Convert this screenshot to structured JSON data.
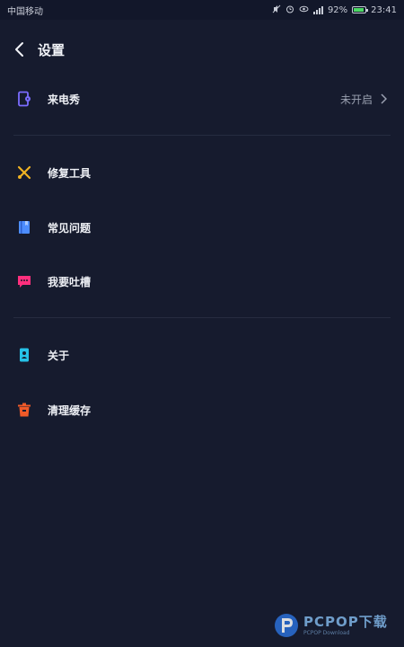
{
  "status_bar": {
    "carrier": "中国移动",
    "icons": [
      "mute-icon",
      "alarm-icon",
      "eye-icon",
      "signal-icon",
      "battery-icon"
    ],
    "battery_percent": "92%",
    "battery_level": 0.92,
    "time": "23:41"
  },
  "header": {
    "back_icon": "chevron-left-icon",
    "title": "设置"
  },
  "menu": {
    "items": [
      {
        "label": "来电秀",
        "value": "未开启",
        "icon": "phone-show-icon",
        "color": "#7b6cff"
      },
      {
        "label": "修复工具",
        "icon": "wrench-icon",
        "color": "#f0b323"
      },
      {
        "label": "常见问题",
        "icon": "book-icon",
        "color": "#4d8dff"
      },
      {
        "label": "我要吐槽",
        "icon": "chat-icon",
        "color": "#ff2f7d"
      },
      {
        "label": "关于",
        "icon": "id-card-icon",
        "color": "#26c2e8"
      },
      {
        "label": "清理缓存",
        "icon": "trash-icon",
        "color": "#f05a28"
      }
    ]
  },
  "watermark": {
    "brand": "PCPOP下载",
    "sub": "PCPOP Download"
  },
  "colors": {
    "background": "#161b2e",
    "divider": "#262c40",
    "text_primary": "#eef0f5",
    "text_secondary": "#9aa0b0"
  }
}
